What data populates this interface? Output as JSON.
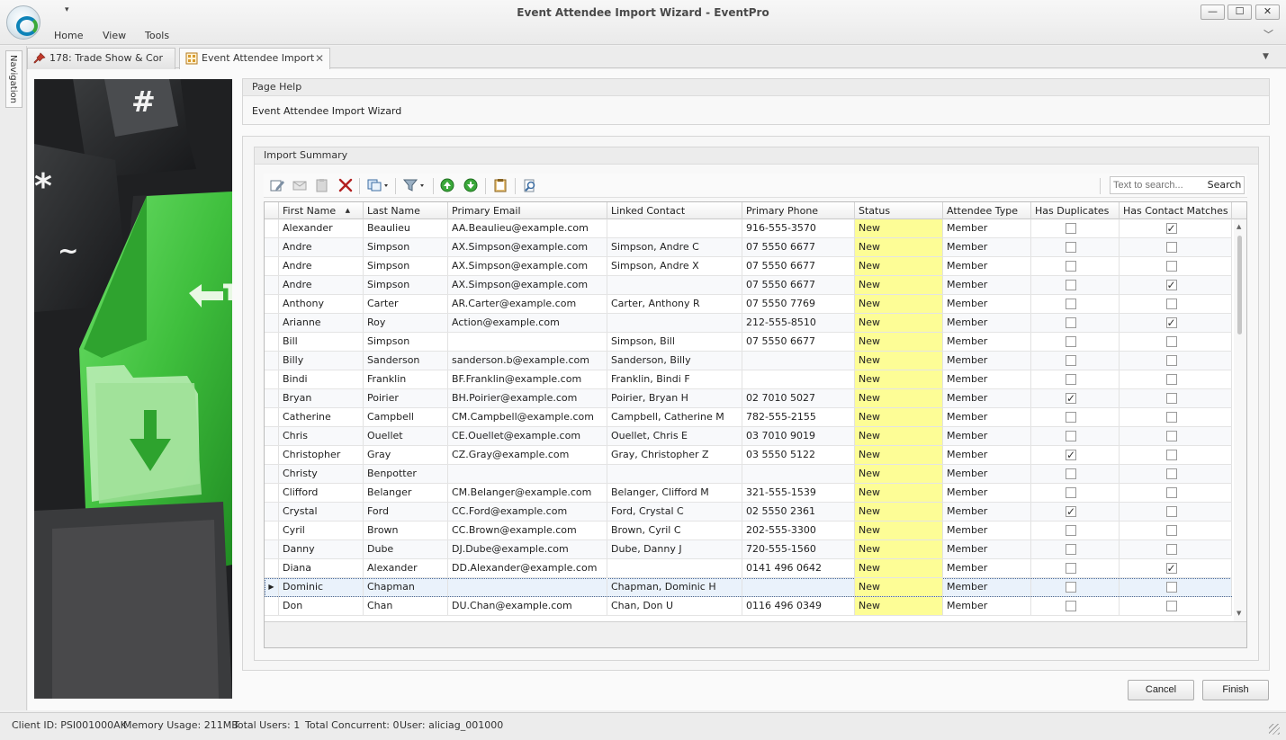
{
  "window": {
    "title": "Event Attendee Import Wizard - EventPro",
    "quick_access_arrow": "▾",
    "minimize": "—",
    "maximize": "☐",
    "close": "✕"
  },
  "menu": {
    "home": "Home",
    "view": "View",
    "tools": "Tools"
  },
  "navigation_label": "Navigation",
  "tabs": [
    {
      "label": "178: Trade Show & Cor",
      "active": false,
      "icon": "pushpin-icon"
    },
    {
      "label": "Event Attendee Import",
      "active": true,
      "icon": "import-wizard-icon"
    }
  ],
  "page_help": {
    "header": "Page Help",
    "text": "Event Attendee Import Wizard"
  },
  "import_summary": {
    "header": "Import Summary"
  },
  "toolbar": {
    "buttons": [
      "edit-icon",
      "email-icon",
      "paste-icon",
      "delete-icon",
      "copy-menu-icon",
      "filter-menu-icon",
      "move-up-icon",
      "move-down-icon",
      "clipboard-icon",
      "find-icon"
    ]
  },
  "search": {
    "placeholder": "Text to search...",
    "button": "Search"
  },
  "grid": {
    "columns": [
      "First Name",
      "Last Name",
      "Primary Email",
      "Linked Contact",
      "Primary Phone",
      "Status",
      "Attendee Type",
      "Has Duplicates",
      "Has Contact Matches"
    ],
    "sorted_column": "First Name",
    "sort_direction": "ascending",
    "rows": [
      {
        "first": "Alexander",
        "last": "Beaulieu",
        "email": "AA.Beaulieu@example.com",
        "contact": "",
        "phone": "916-555-3570",
        "status": "New",
        "type": "Member",
        "dup": false,
        "match": true
      },
      {
        "first": "Andre",
        "last": "Simpson",
        "email": "AX.Simpson@example.com",
        "contact": "Simpson, Andre C",
        "phone": "07 5550 6677",
        "status": "New",
        "type": "Member",
        "dup": false,
        "match": false
      },
      {
        "first": "Andre",
        "last": "Simpson",
        "email": "AX.Simpson@example.com",
        "contact": "Simpson, Andre X",
        "phone": "07 5550 6677",
        "status": "New",
        "type": "Member",
        "dup": false,
        "match": false
      },
      {
        "first": "Andre",
        "last": "Simpson",
        "email": "AX.Simpson@example.com",
        "contact": "",
        "phone": "07 5550 6677",
        "status": "New",
        "type": "Member",
        "dup": false,
        "match": true
      },
      {
        "first": "Anthony",
        "last": "Carter",
        "email": "AR.Carter@example.com",
        "contact": "Carter, Anthony R",
        "phone": "07 5550 7769",
        "status": "New",
        "type": "Member",
        "dup": false,
        "match": false
      },
      {
        "first": "Arianne",
        "last": "Roy",
        "email": "Action@example.com",
        "contact": "",
        "phone": "212-555-8510",
        "status": "New",
        "type": "Member",
        "dup": false,
        "match": true
      },
      {
        "first": "Bill",
        "last": "Simpson",
        "email": "",
        "contact": "Simpson, Bill",
        "phone": "07 5550 6677",
        "status": "New",
        "type": "Member",
        "dup": false,
        "match": false
      },
      {
        "first": "Billy",
        "last": "Sanderson",
        "email": "sanderson.b@example.com",
        "contact": "Sanderson, Billy",
        "phone": "",
        "status": "New",
        "type": "Member",
        "dup": false,
        "match": false
      },
      {
        "first": "Bindi",
        "last": "Franklin",
        "email": "BF.Franklin@example.com",
        "contact": "Franklin, Bindi F",
        "phone": "",
        "status": "New",
        "type": "Member",
        "dup": false,
        "match": false
      },
      {
        "first": "Bryan",
        "last": "Poirier",
        "email": "BH.Poirier@example.com",
        "contact": "Poirier, Bryan H",
        "phone": "02 7010 5027",
        "status": "New",
        "type": "Member",
        "dup": true,
        "match": false
      },
      {
        "first": "Catherine",
        "last": "Campbell",
        "email": "CM.Campbell@example.com",
        "contact": "Campbell, Catherine M",
        "phone": "782-555-2155",
        "status": "New",
        "type": "Member",
        "dup": false,
        "match": false
      },
      {
        "first": "Chris",
        "last": "Ouellet",
        "email": "CE.Ouellet@example.com",
        "contact": "Ouellet, Chris E",
        "phone": "03 7010 9019",
        "status": "New",
        "type": "Member",
        "dup": false,
        "match": false
      },
      {
        "first": "Christopher",
        "last": "Gray",
        "email": "CZ.Gray@example.com",
        "contact": "Gray, Christopher Z",
        "phone": "03 5550 5122",
        "status": "New",
        "type": "Member",
        "dup": true,
        "match": false
      },
      {
        "first": "Christy",
        "last": "Benpotter",
        "email": "",
        "contact": "",
        "phone": "",
        "status": "New",
        "type": "Member",
        "dup": false,
        "match": false
      },
      {
        "first": "Clifford",
        "last": "Belanger",
        "email": "CM.Belanger@example.com",
        "contact": "Belanger, Clifford M",
        "phone": "321-555-1539",
        "status": "New",
        "type": "Member",
        "dup": false,
        "match": false
      },
      {
        "first": "Crystal",
        "last": "Ford",
        "email": "CC.Ford@example.com",
        "contact": "Ford, Crystal C",
        "phone": "02 5550 2361",
        "status": "New",
        "type": "Member",
        "dup": true,
        "match": false
      },
      {
        "first": "Cyril",
        "last": "Brown",
        "email": "CC.Brown@example.com",
        "contact": "Brown, Cyril C",
        "phone": "202-555-3300",
        "status": "New",
        "type": "Member",
        "dup": false,
        "match": false
      },
      {
        "first": "Danny",
        "last": "Dube",
        "email": "DJ.Dube@example.com",
        "contact": "Dube, Danny J",
        "phone": "720-555-1560",
        "status": "New",
        "type": "Member",
        "dup": false,
        "match": false
      },
      {
        "first": "Diana",
        "last": "Alexander",
        "email": "DD.Alexander@example.com",
        "contact": "",
        "phone": "0141 496 0642",
        "status": "New",
        "type": "Member",
        "dup": false,
        "match": true
      },
      {
        "first": "Dominic",
        "last": "Chapman",
        "email": "",
        "contact": "Chapman, Dominic H",
        "phone": "",
        "status": "New",
        "type": "Member",
        "dup": false,
        "match": false,
        "selected": true
      },
      {
        "first": "Don",
        "last": "Chan",
        "email": "DU.Chan@example.com",
        "contact": "Chan, Don U",
        "phone": "0116 496 0349",
        "status": "New",
        "type": "Member",
        "dup": false,
        "match": false
      }
    ]
  },
  "buttons": {
    "cancel": "Cancel",
    "finish": "Finish"
  },
  "statusbar": {
    "client_id": "Client ID: PSI001000AK",
    "memory": "Memory Usage: 211MB",
    "total_users": "Total Users: 1",
    "total_concurrent": "Total Concurrent: 0",
    "user": "User: aliciag_001000"
  },
  "colors": {
    "status_highlight": "#fdfd96",
    "accent_green": "#43c143",
    "selection": "#eaf2fb"
  }
}
